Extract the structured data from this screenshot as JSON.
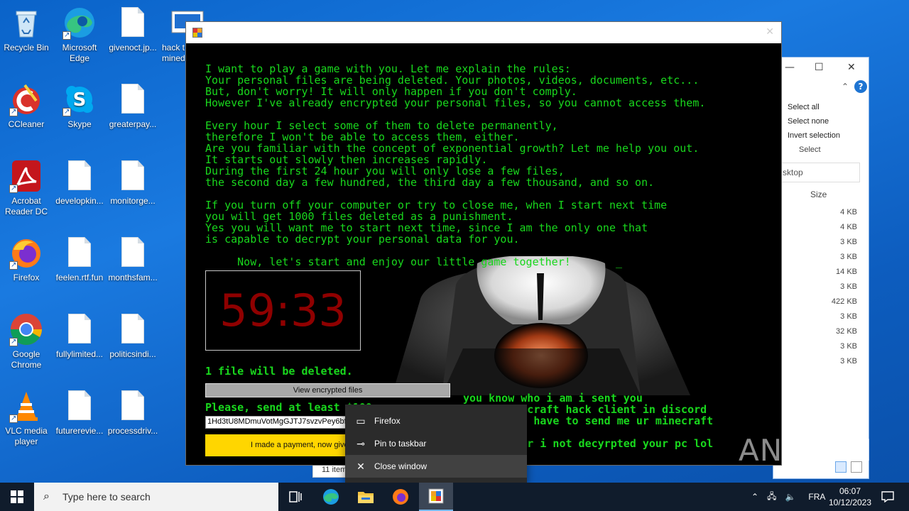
{
  "desktop": {
    "icons": [
      {
        "label": "Recycle Bin",
        "icon": "recycle-bin-icon"
      },
      {
        "label": "Microsoft Edge",
        "icon": "edge-icon"
      },
      {
        "label": "givenoct.jp...",
        "icon": "file-icon"
      },
      {
        "label": "hack t mined",
        "icon": "app-icon"
      },
      {
        "label": "CCleaner",
        "icon": "ccleaner-icon"
      },
      {
        "label": "Skype",
        "icon": "skype-icon"
      },
      {
        "label": "greaterpay...",
        "icon": "file-icon"
      },
      {
        "label": "Acrobat Reader DC",
        "icon": "acrobat-icon"
      },
      {
        "label": "developkin...",
        "icon": "file-icon"
      },
      {
        "label": "monitorge...",
        "icon": "file-icon"
      },
      {
        "label": "Firefox",
        "icon": "firefox-icon"
      },
      {
        "label": "feelen.rtf.fun",
        "icon": "file-icon"
      },
      {
        "label": "monthsfam...",
        "icon": "file-icon"
      },
      {
        "label": "Google Chrome",
        "icon": "chrome-icon"
      },
      {
        "label": "fullylimited...",
        "icon": "file-icon"
      },
      {
        "label": "politicsindi...",
        "icon": "file-icon"
      },
      {
        "label": "VLC media player",
        "icon": "vlc-icon"
      },
      {
        "label": "futurerevie...",
        "icon": "file-icon"
      },
      {
        "label": "processdriv...",
        "icon": "file-icon"
      }
    ]
  },
  "explorer": {
    "ribbon": [
      "Select all",
      "Select none",
      "Invert selection"
    ],
    "group_label": "Select",
    "search_text": "sktop",
    "size_header": "Size",
    "sizes": [
      "4 KB",
      "4 KB",
      "3 KB",
      "3 KB",
      "14 KB",
      "3 KB",
      "422 KB",
      "3 KB",
      "32 KB",
      "3 KB",
      "3 KB"
    ],
    "status": "11 item"
  },
  "ransom": {
    "message": "I want to play a game with you. Let me explain the rules:\nYour personal files are being deleted. Your photos, videos, documents, etc...\nBut, don't worry! It will only happen if you don't comply.\nHowever I've already encrypted your personal files, so you cannot access them.\n\nEvery hour I select some of them to delete permanently,\ntherefore I won't be able to access them, either.\nAre you familiar with the concept of exponential growth? Let me help you out.\nIt starts out slowly then increases rapidly.\nDuring the first 24 hour you will only lose a few files,\nthe second day a few hundred, the third day a few thousand, and so on.\n\nIf you turn off your computer or try to close me, when I start next time\nyou will get 1000 files deleted as a punishment.\nYes you will want me to start next time, since I am the only one that\nis capable to decrypt your personal data for you.\n\n     Now, let's start and enjoy our little game together!       _",
    "timer": "59:33",
    "delete_notice": "1 file will be deleted.",
    "view_button": "View encrypted files",
    "send_text": "Please, send at least $100",
    "wallet": "1Hd3tU8MDmuVotMgGJTJ7svzvPey6bf",
    "pay_button": "I made a payment, now give",
    "side_text": "you know who i am i sent you\n          craft hack client in discord\n         r have to send me ur minecraft\n\n         or i not decyrpted your pc lol"
  },
  "context_menu": {
    "items": [
      {
        "label": "Firefox",
        "icon": "app-window-icon"
      },
      {
        "label": "Pin to taskbar",
        "icon": "pin-icon"
      },
      {
        "label": "Close window",
        "icon": "close-icon"
      }
    ]
  },
  "watermark": "ANY.RUN",
  "taskbar": {
    "search_placeholder": "Type here to search",
    "language": "FRA",
    "time": "06:07",
    "date": "10/12/2023"
  }
}
